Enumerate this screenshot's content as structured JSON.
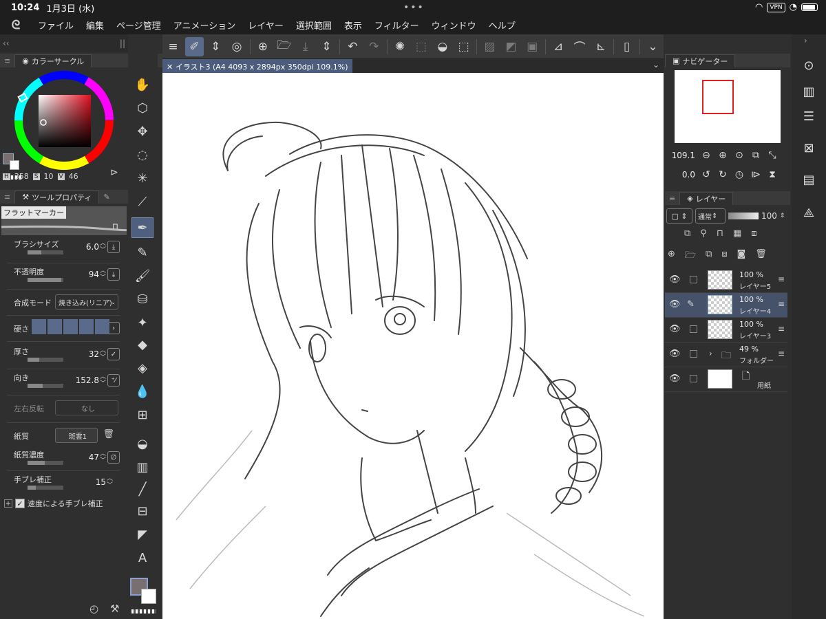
{
  "status": {
    "time": "10:24",
    "date": "1月3日 (水)",
    "vpn": "VPN"
  },
  "menu": [
    "ファイル",
    "編集",
    "ページ管理",
    "アニメーション",
    "レイヤー",
    "選択範囲",
    "表示",
    "フィルター",
    "ウィンドウ",
    "ヘルプ"
  ],
  "color_panel": {
    "title": "カラーサークル",
    "h_label": "H",
    "h": "358",
    "s_label": "S",
    "s": "10",
    "v_label": "V",
    "v": "46",
    "main_color": "#7a6f70",
    "sub_color": "#ffffff"
  },
  "tool_property": {
    "title": "ツールプロパティ",
    "brush_name": "フラットマーカー",
    "brush_size_label": "ブラシサイズ",
    "brush_size": "6.0",
    "opacity_label": "不透明度",
    "opacity": "94",
    "blend_label": "合成モード",
    "blend": "焼き込み(リニア)",
    "hardness_label": "硬さ",
    "thickness_label": "厚さ",
    "thickness": "32",
    "direction_label": "向き",
    "direction": "152.8",
    "flip_label": "左右反転",
    "flip": "なし",
    "paper_label": "紙質",
    "paper": "斑雲1",
    "paper_density_label": "紙質濃度",
    "paper_density": "47",
    "stabilization_label": "手ブレ補正",
    "stabilization": "15",
    "speed_stab_label": "速度による手ブレ補正"
  },
  "document": {
    "tab": "イラスト3 (A4 4093 x 2894px 350dpi 109.1%)"
  },
  "navigator": {
    "title": "ナビゲーター",
    "zoom": "109.1",
    "rotation": "0.0"
  },
  "layers": {
    "title": "レイヤー",
    "blend": "通常",
    "opacity": "100",
    "items": [
      {
        "pct": "100 %",
        "name": "レイヤー5"
      },
      {
        "pct": "100 %",
        "name": "レイヤー4"
      },
      {
        "pct": "100 %",
        "name": "レイヤー3"
      },
      {
        "pct": "49 %",
        "name": "フォルダー"
      },
      {
        "pct": "",
        "name": "用紙"
      }
    ]
  }
}
